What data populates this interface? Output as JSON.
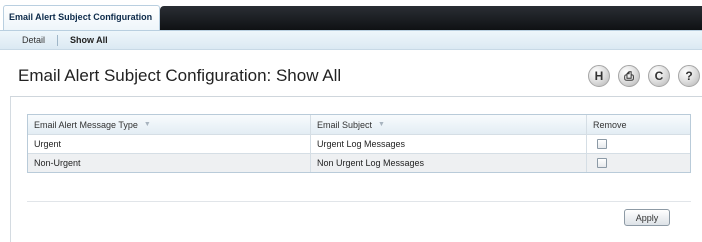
{
  "tabs": {
    "active_label": "Email Alert Subject Configuration"
  },
  "subnav": {
    "detail": "Detail",
    "show_all": "Show All"
  },
  "page": {
    "title": "Email Alert Subject Configuration: Show All"
  },
  "header_icons": [
    {
      "name": "save-icon",
      "glyph": "H"
    },
    {
      "name": "print-icon",
      "glyph": "⎙"
    },
    {
      "name": "refresh-icon",
      "glyph": "C"
    },
    {
      "name": "help-icon",
      "glyph": "?"
    }
  ],
  "table": {
    "columns": [
      "Email Alert Message Type",
      "Email Subject",
      "Remove"
    ],
    "sort_glyph": "▼",
    "rows": [
      {
        "type": "Urgent",
        "subject": "Urgent Log Messages",
        "remove": false
      },
      {
        "type": "Non-Urgent",
        "subject": "Non Urgent Log Messages",
        "remove": false
      }
    ]
  },
  "actions": {
    "apply": "Apply"
  }
}
